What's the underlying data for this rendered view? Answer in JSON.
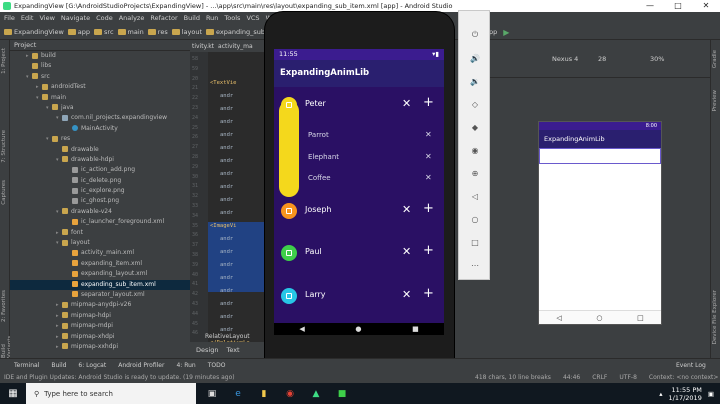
{
  "window": {
    "title": "ExpandingView [G:\\AndroidStudioProjects\\ExpandingView] - ...\\app\\src\\main\\res\\layout\\expanding_sub_item.xml [app] - Android Studio",
    "minimize": "—",
    "maximize": "□",
    "close": "✕"
  },
  "menu": [
    "File",
    "Edit",
    "View",
    "Navigate",
    "Code",
    "Analyze",
    "Refactor",
    "Build",
    "Run",
    "Tools",
    "VCS",
    "Window"
  ],
  "breadcrumbs": [
    "ExpandingView",
    "app",
    "src",
    "main",
    "res",
    "layout",
    "expanding_sub_item.xml"
  ],
  "toolbar": {
    "run_config": "app",
    "device": "Nexus 4",
    "api": "28",
    "zoom": "30%"
  },
  "project_panel": {
    "title": "Project",
    "rows": [
      {
        "label": "build",
        "icon": "folder",
        "indent": 2,
        "arrow": "▸"
      },
      {
        "label": "libs",
        "icon": "folder",
        "indent": 2,
        "arrow": ""
      },
      {
        "label": "src",
        "icon": "folder",
        "indent": 2,
        "arrow": "▾"
      },
      {
        "label": "androidTest",
        "icon": "folder",
        "indent": 3,
        "arrow": "▸"
      },
      {
        "label": "main",
        "icon": "folder",
        "indent": 3,
        "arrow": "▾"
      },
      {
        "label": "java",
        "icon": "folder",
        "indent": 4,
        "arrow": "▾"
      },
      {
        "label": "com.nil_projects.expandingview",
        "icon": "pkg",
        "indent": 5,
        "arrow": "▾"
      },
      {
        "label": "MainActivity",
        "icon": "cls",
        "indent": 6,
        "arrow": ""
      },
      {
        "label": "res",
        "icon": "folder",
        "indent": 4,
        "arrow": "▾"
      },
      {
        "label": "drawable",
        "icon": "folder",
        "indent": 5,
        "arrow": ""
      },
      {
        "label": "drawable-hdpi",
        "icon": "folder",
        "indent": 5,
        "arrow": "▾"
      },
      {
        "label": "ic_action_add.png",
        "icon": "png",
        "indent": 6,
        "arrow": ""
      },
      {
        "label": "ic_delete.png",
        "icon": "png",
        "indent": 6,
        "arrow": ""
      },
      {
        "label": "ic_explore.png",
        "icon": "png",
        "indent": 6,
        "arrow": ""
      },
      {
        "label": "ic_ghost.png",
        "icon": "png",
        "indent": 6,
        "arrow": ""
      },
      {
        "label": "drawable-v24",
        "icon": "folder",
        "indent": 5,
        "arrow": "▾"
      },
      {
        "label": "ic_launcher_foreground.xml",
        "icon": "xml",
        "indent": 6,
        "arrow": ""
      },
      {
        "label": "font",
        "icon": "folder",
        "indent": 5,
        "arrow": "▸"
      },
      {
        "label": "layout",
        "icon": "folder",
        "indent": 5,
        "arrow": "▾"
      },
      {
        "label": "activity_main.xml",
        "icon": "xml",
        "indent": 6,
        "arrow": ""
      },
      {
        "label": "expanding_item.xml",
        "icon": "xml",
        "indent": 6,
        "arrow": ""
      },
      {
        "label": "expanding_layout.xml",
        "icon": "xml",
        "indent": 6,
        "arrow": ""
      },
      {
        "label": "expanding_sub_item.xml",
        "icon": "xml",
        "indent": 6,
        "arrow": "",
        "selected": true
      },
      {
        "label": "separator_layout.xml",
        "icon": "xml",
        "indent": 6,
        "arrow": ""
      },
      {
        "label": "mipmap-anydpi-v26",
        "icon": "folder",
        "indent": 5,
        "arrow": "▸"
      },
      {
        "label": "mipmap-hdpi",
        "icon": "folder",
        "indent": 5,
        "arrow": "▸"
      },
      {
        "label": "mipmap-mdpi",
        "icon": "folder",
        "indent": 5,
        "arrow": "▸"
      },
      {
        "label": "mipmap-xhdpi",
        "icon": "folder",
        "indent": 5,
        "arrow": "▸"
      },
      {
        "label": "mipmap-xxhdpi",
        "icon": "folder",
        "indent": 5,
        "arrow": "▸"
      }
    ]
  },
  "editor": {
    "tabs": [
      "tivity.kt",
      "activity_ma"
    ],
    "line_numbers": [
      "58",
      "59",
      "20",
      "21",
      "22",
      "23",
      "24",
      "25",
      "26",
      "27",
      "28",
      "29",
      "30",
      "31",
      "32",
      "33",
      "34",
      "35",
      "36",
      "37",
      "38",
      "39",
      "40",
      "41",
      "42",
      "43",
      "44",
      "45",
      "46"
    ],
    "code": [
      "<TextVie",
      "andr",
      "andr",
      "andr",
      "andr",
      "andr",
      "andr",
      "andr",
      "andr",
      "andr",
      "andr",
      "<ImageVi",
      "andr",
      "andr",
      "andr",
      "andr",
      "andr",
      "andr",
      "andr",
      "andr",
      "</RelativeLa"
    ],
    "bottom_crumb": "RelativeLayout",
    "design_tab": "Design",
    "text_tab": "Text"
  },
  "emulator": {
    "time": "11:55",
    "app_title": "ExpandingAnimLib",
    "close_glyph": "✕",
    "add_glyph": "+",
    "items": [
      {
        "name": "Peter",
        "color": "#f4d81c",
        "expanded": true
      },
      {
        "name": "Joseph",
        "color": "#f7941d"
      },
      {
        "name": "Paul",
        "color": "#3ecf4a"
      },
      {
        "name": "Larry",
        "color": "#27c6e6"
      }
    ],
    "sub_items": [
      "Parrot",
      "Elephant",
      "Coffee"
    ],
    "nav": [
      "◀",
      "●",
      "■"
    ]
  },
  "emulator_controls": [
    "⏻",
    "🔊",
    "🔉",
    "◇",
    "◆",
    "◉",
    "⊕",
    "◁",
    "○",
    "□",
    "⋯"
  ],
  "preview": {
    "time": "8:00",
    "app_title": "ExpandingAnimLib",
    "nav": [
      "◁",
      "○",
      "□"
    ]
  },
  "tool_windows": [
    "Terminal",
    "Build",
    "6: Logcat",
    "Android Profiler",
    "4: Run",
    "TODO"
  ],
  "event_log": "Event Log",
  "status_message": "IDE and Plugin Updates: Android Studio is ready to update. (19 minutes ago)",
  "status_right": [
    "418 chars, 10 line breaks",
    "44:46",
    "CRLF",
    "UTF-8",
    "Context: <no context>"
  ],
  "taskbar": {
    "search_placeholder": "Type here to search",
    "time": "11:55 PM",
    "date": "1/17/2019"
  },
  "colors": {
    "accent_purple": "#2a1064",
    "status_bar": "#3b1c8f",
    "app_bar": "#2a1f6f",
    "ide_background": "#3c3f41",
    "editor_background": "#2b2b2b"
  }
}
